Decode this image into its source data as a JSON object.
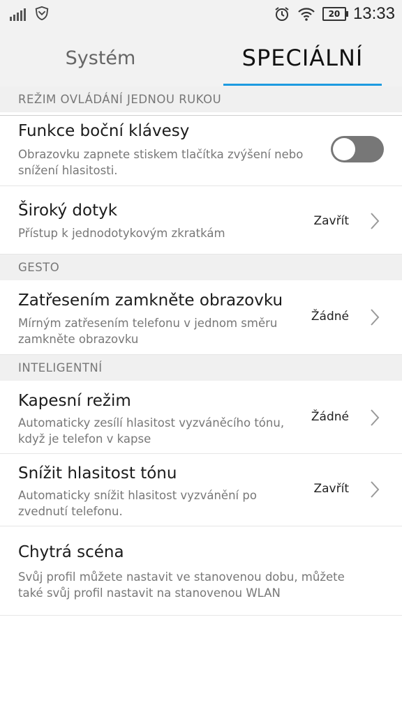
{
  "status_bar": {
    "time": "13:33",
    "battery": "20",
    "icons": [
      "signal-icon",
      "shield-icon",
      "alarm-icon",
      "wifi-icon",
      "battery-icon"
    ]
  },
  "tabs": [
    {
      "label": "Systém",
      "active": false
    },
    {
      "label": "SPECIÁLNÍ",
      "active": true
    }
  ],
  "sections": {
    "one_hand": "REŽIM OVLÁDÁNÍ JEDNOU RUKOU",
    "gesture": "GESTO",
    "intelligent": "INTELIGENTNÍ"
  },
  "items": {
    "side_key": {
      "title": "Funkce boční klávesy",
      "desc": "Obrazovku zapnete stiskem tlačítka zvýšení nebo snížení hlasitosti.",
      "toggle_on": false
    },
    "wide_touch": {
      "title": "Široký dotyk",
      "desc": "Přístup k jednodotykovým zkratkám",
      "value": "Zavřít"
    },
    "shake_lock": {
      "title": "Zatřesením zamkněte obrazovku",
      "desc": "Mírným zatřesením telefonu v jednom směru zamkněte obrazovku",
      "value": "Žádné"
    },
    "pocket_mode": {
      "title": "Kapesní režim",
      "desc": "Automaticky zesílí hlasitost vyzváněcího tónu, když je telefon v kapse",
      "value": "Žádné"
    },
    "lower_tone": {
      "title": "Snížit hlasitost tónu",
      "desc": "Automaticky snížit hlasitost vyzvánění po zvednutí telefonu.",
      "value": "Zavřít"
    },
    "smart_scene": {
      "title": "Chytrá scéna",
      "desc": "Svůj profil můžete nastavit ve stanovenou dobu, můžete také svůj profil nastavit na stanovenou WLAN"
    }
  },
  "colors": {
    "accent": "#1e9be0",
    "toggle_off": "#777777",
    "section_bg": "#f0f0f0"
  }
}
